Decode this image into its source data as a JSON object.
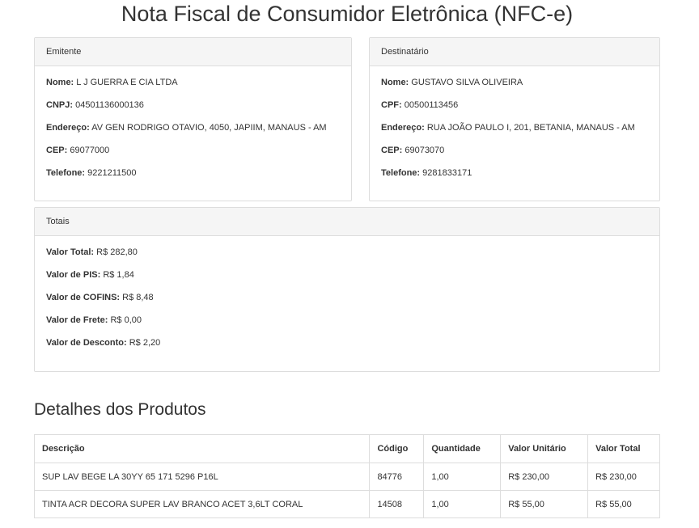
{
  "title": "Nota Fiscal de Consumidor Eletrônica (NFC-e)",
  "emitente": {
    "heading": "Emitente",
    "fields": [
      {
        "label": "Nome:",
        "value": "L J GUERRA E CIA LTDA"
      },
      {
        "label": "CNPJ:",
        "value": "04501136000136"
      },
      {
        "label": "Endereço:",
        "value": "AV GEN RODRIGO OTAVIO, 4050, JAPIIM, MANAUS - AM"
      },
      {
        "label": "CEP:",
        "value": "69077000"
      },
      {
        "label": "Telefone:",
        "value": "9221211500"
      }
    ]
  },
  "destinatario": {
    "heading": "Destinatário",
    "fields": [
      {
        "label": "Nome:",
        "value": "GUSTAVO SILVA OLIVEIRA"
      },
      {
        "label": "CPF:",
        "value": "00500113456"
      },
      {
        "label": "Endereço:",
        "value": "RUA JOÃO PAULO I, 201, BETANIA, MANAUS - AM"
      },
      {
        "label": "CEP:",
        "value": "69073070"
      },
      {
        "label": "Telefone:",
        "value": "9281833171"
      }
    ]
  },
  "totais": {
    "heading": "Totais",
    "fields": [
      {
        "label": "Valor Total:",
        "value": "R$ 282,80"
      },
      {
        "label": "Valor de PIS:",
        "value": "R$ 1,84"
      },
      {
        "label": "Valor de COFINS:",
        "value": "R$ 8,48"
      },
      {
        "label": "Valor de Frete:",
        "value": "R$ 0,00"
      },
      {
        "label": "Valor de Desconto:",
        "value": "R$ 2,20"
      }
    ]
  },
  "produtos": {
    "heading": "Detalhes dos Produtos",
    "columns": [
      "Descrição",
      "Código",
      "Quantidade",
      "Valor Unitário",
      "Valor Total"
    ],
    "rows": [
      [
        "SUP LAV BEGE LA 30YY 65 171 5296 P16L",
        "84776",
        "1,00",
        "R$ 230,00",
        "R$ 230,00"
      ],
      [
        "TINTA ACR DECORA SUPER LAV BRANCO ACET 3,6LT CORAL",
        "14508",
        "1,00",
        "R$ 55,00",
        "R$ 55,00"
      ]
    ]
  }
}
